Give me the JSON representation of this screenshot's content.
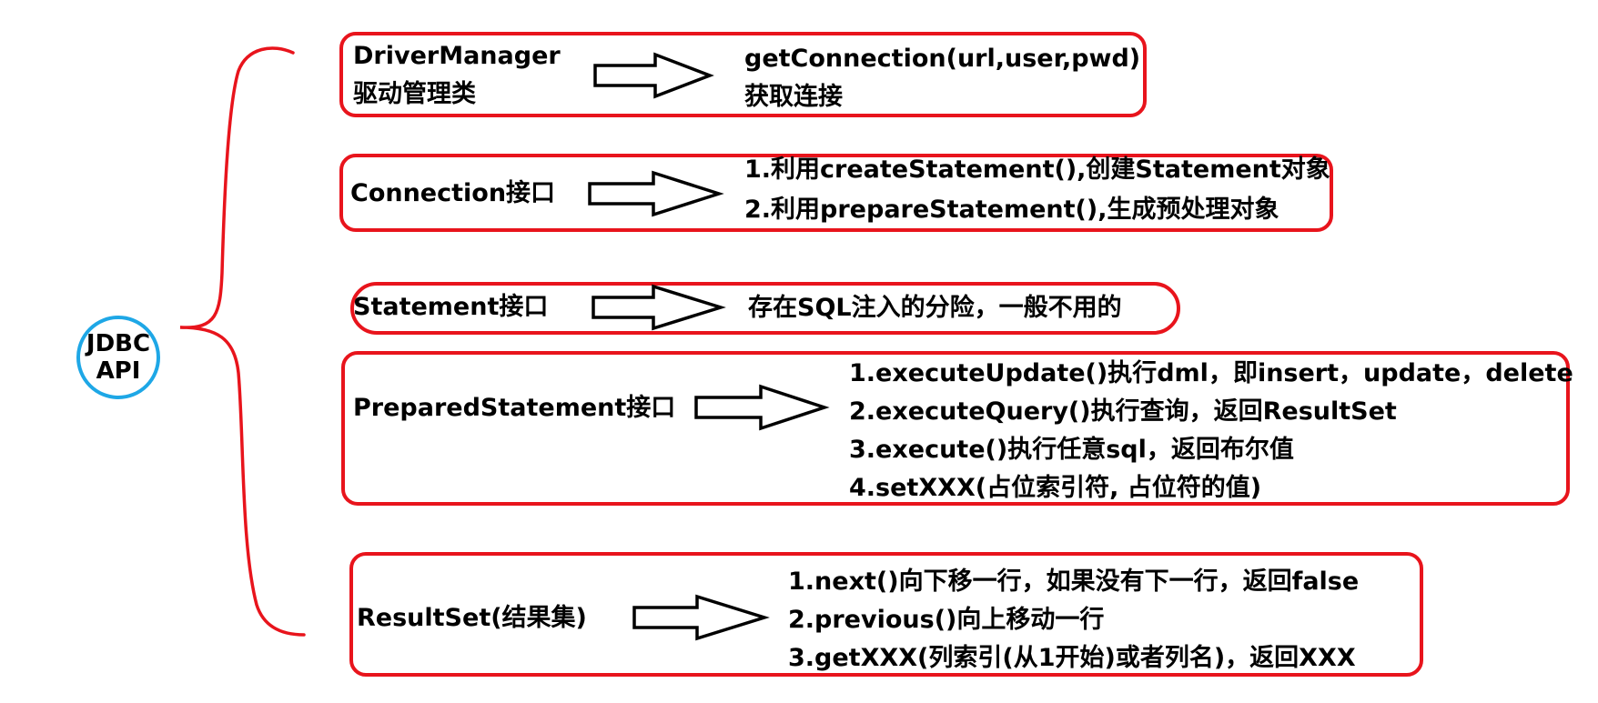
{
  "root": {
    "line1": "JDBC",
    "line2": "API"
  },
  "nodes": [
    {
      "id": "driver-manager",
      "title_lines": [
        "DriverManager",
        "驱动管理类"
      ],
      "description_lines": [
        "getConnection(url,user,pwd)",
        "获取连接"
      ]
    },
    {
      "id": "connection",
      "title_lines": [
        "Connection接口"
      ],
      "description_lines": [
        "1.利用createStatement(),创建Statement对象",
        "2.利用prepareStatement(),生成预处理对象"
      ]
    },
    {
      "id": "statement",
      "title_lines": [
        "Statement接口"
      ],
      "description_lines": [
        "存在SQL注入的分险，一般不用的"
      ]
    },
    {
      "id": "prepared-statement",
      "title_lines": [
        "PreparedStatement接口"
      ],
      "description_lines": [
        "1.executeUpdate()执行dml，即insert，update，delete",
        "2.executeQuery()执行查询，返回ResultSet",
        "3.execute()执行任意sql，返回布尔值",
        "4.setXXX(占位索引符, 占位符的值)"
      ]
    },
    {
      "id": "result-set",
      "title_lines": [
        "ResultSet(结果集)"
      ],
      "description_lines": [
        "1.next()向下移一行，如果没有下一行，返回false",
        "2.previous()向上移动一行",
        "3.getXXX(列索引(从1开始)或者列名)，返回XXX"
      ]
    }
  ],
  "colors": {
    "box_border": "#e8141c",
    "brace": "#e8141c",
    "root_circle": "#1ea7e6",
    "arrow": "#000000"
  }
}
